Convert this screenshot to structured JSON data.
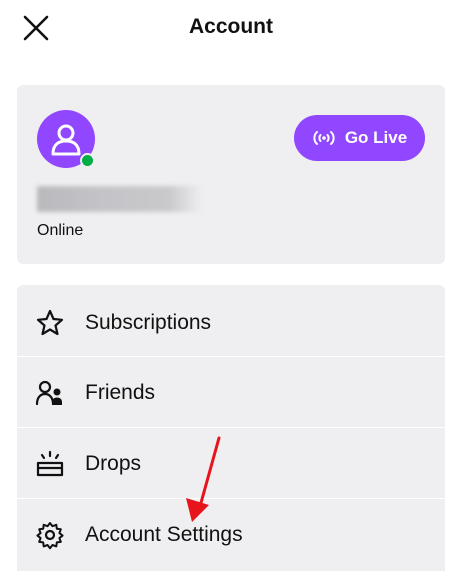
{
  "header": {
    "title": "Account",
    "close_icon": "close-icon"
  },
  "profile": {
    "status": "Online",
    "go_live_label": "Go Live",
    "colors": {
      "brand": "#9146ff",
      "online": "#00ad46",
      "card_bg": "#efeff1"
    }
  },
  "menu": {
    "items": [
      {
        "label": "Subscriptions",
        "icon": "star-icon"
      },
      {
        "label": "Friends",
        "icon": "friends-icon"
      },
      {
        "label": "Drops",
        "icon": "drops-icon"
      },
      {
        "label": "Account Settings",
        "icon": "gear-icon"
      }
    ]
  },
  "annotation": {
    "arrow_color": "#e8141c",
    "arrow_icon": "red-arrow-annotation"
  }
}
